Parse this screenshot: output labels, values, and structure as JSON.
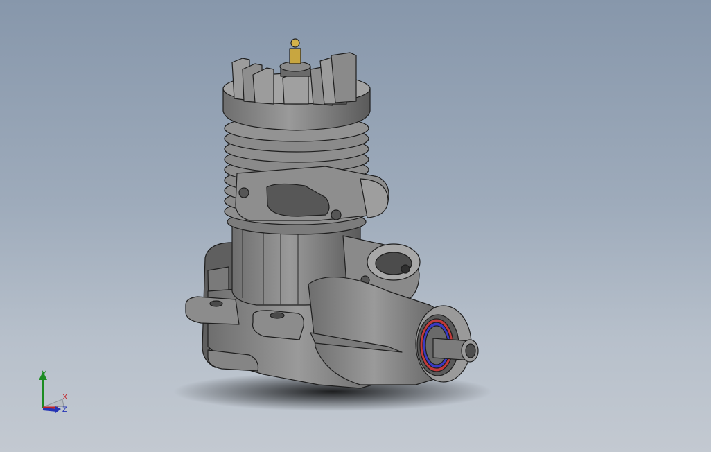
{
  "viewport": {
    "background_top": "#8797ab",
    "background_bottom": "#c3c9d1"
  },
  "model": {
    "part_color": "#8a8a8a",
    "edge_color": "#1e1e1e",
    "plug_color": "#c8a640",
    "bearing_colors": [
      "#c23a3a",
      "#3a3ac2"
    ]
  },
  "triad": {
    "y_label": "Y",
    "x_label": "X",
    "z_label": "Z",
    "y_color": "#1c8c22",
    "x_color": "#c2242a",
    "z_color": "#2433b5"
  }
}
